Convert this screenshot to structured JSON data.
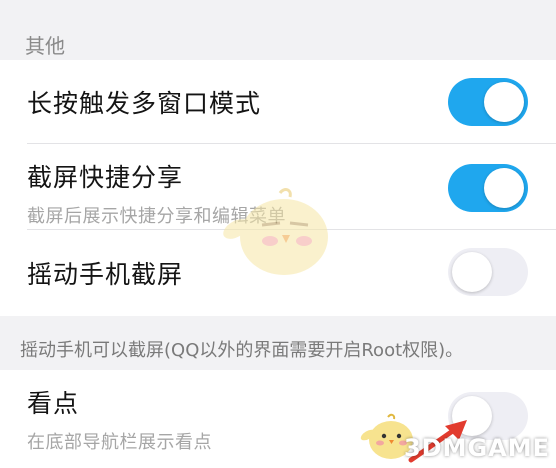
{
  "section": {
    "header": "其他"
  },
  "rows": [
    {
      "title": "长按触发多窗口模式",
      "toggle": "on"
    },
    {
      "title": "截屏快捷分享",
      "subtitle": "截屏后展示快捷分享和编辑菜单",
      "toggle": "on"
    },
    {
      "title": "摇动手机截屏",
      "toggle": "off"
    },
    {
      "title": "看点",
      "subtitle": "在底部导航栏展示看点",
      "toggle": "off"
    }
  ],
  "note": "摇动手机可以截屏(QQ以外的界面需要开启Root权限)。",
  "watermark": "3DMGAME",
  "colors": {
    "toggle_on": "#1fa7ee",
    "toggle_off": "#eeeef4",
    "background": "#f2f2f4"
  }
}
